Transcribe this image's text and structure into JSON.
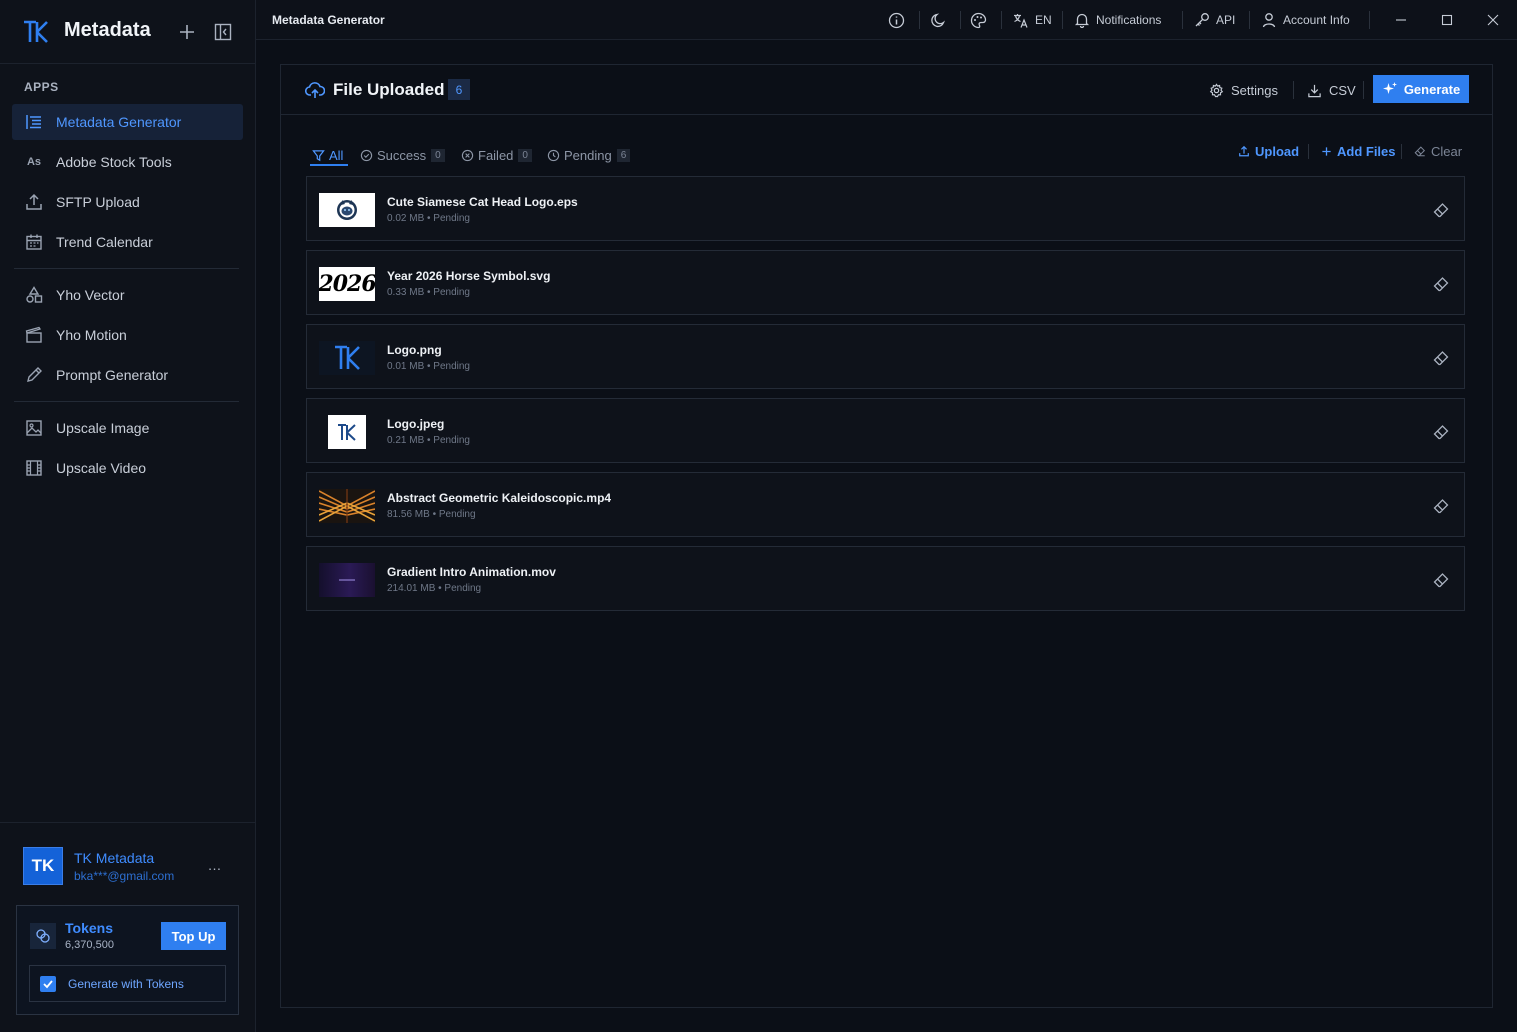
{
  "sidebar": {
    "brand_title": "Metadata",
    "section_heading": "APPS",
    "items": [
      {
        "label": "Metadata Generator",
        "icon": "list-icon",
        "active": true
      },
      {
        "label": "Adobe Stock Tools",
        "icon": "As"
      },
      {
        "label": "SFTP Upload",
        "icon": "upload-icon"
      },
      {
        "label": "Trend Calendar",
        "icon": "calendar-icon"
      },
      {
        "label": "Yho Vector",
        "icon": "shapes-icon"
      },
      {
        "label": "Yho Motion",
        "icon": "clapperboard-icon"
      },
      {
        "label": "Prompt Generator",
        "icon": "pencil-icon"
      },
      {
        "label": "Upscale Image",
        "icon": "image-icon"
      },
      {
        "label": "Upscale Video",
        "icon": "film-icon"
      }
    ],
    "user": {
      "initials": "TK",
      "name": "TK Metadata",
      "email": "bka***@gmail.com",
      "menu": "…"
    },
    "tokens": {
      "label": "Tokens",
      "count": "6,370,500",
      "topup_label": "Top Up",
      "generate_with_tokens": "Generate with Tokens",
      "generate_with_tokens_checked": true
    }
  },
  "titlebar": {
    "title": "Metadata Generator",
    "language": "EN",
    "notifications": "Notifications",
    "api": "API",
    "account": "Account Info"
  },
  "panel": {
    "title": "File Uploaded",
    "count": "6",
    "settings_label": "Settings",
    "csv_label": "CSV",
    "generate_label": "Generate",
    "tabs": [
      {
        "label": "All",
        "count": ""
      },
      {
        "label": "Success",
        "count": "0"
      },
      {
        "label": "Failed",
        "count": "0"
      },
      {
        "label": "Pending",
        "count": "6"
      }
    ],
    "actions": {
      "upload": "Upload",
      "add_files": "Add Files",
      "clear": "Clear"
    },
    "files": [
      {
        "name": "Cute Siamese Cat Head Logo.eps",
        "meta": "0.02 MB • Pending",
        "thumb": "cat"
      },
      {
        "name": "Year 2026 Horse Symbol.svg",
        "meta": "0.33 MB • Pending",
        "thumb": "2026",
        "thumb_text": "2026"
      },
      {
        "name": "Logo.png",
        "meta": "0.01 MB • Pending",
        "thumb": "logo-dark"
      },
      {
        "name": "Logo.jpeg",
        "meta": "0.21 MB • Pending",
        "thumb": "logo-light"
      },
      {
        "name": "Abstract Geometric Kaleidoscopic.mp4",
        "meta": "81.56 MB • Pending",
        "thumb": "pattern"
      },
      {
        "name": "Gradient Intro Animation.mov",
        "meta": "214.01 MB • Pending",
        "thumb": "gradient"
      }
    ]
  },
  "colors": {
    "accent": "#2f7ff0",
    "accent_text": "#4f97ff",
    "background": "#0b0f17"
  }
}
